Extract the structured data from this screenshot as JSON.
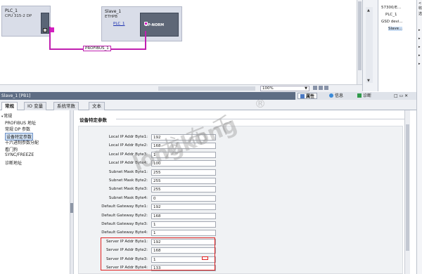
{
  "network": {
    "plc": {
      "name": "PLC_1",
      "type": "CPU 315-2 DP"
    },
    "slave": {
      "name": "Slave_1",
      "type": "ETHPB",
      "link": "PLC_1",
      "module_label": "DP-NORM"
    },
    "bus_label": "PROFIBUS_1",
    "zoom": "100%"
  },
  "catalog": {
    "rows": [
      "57300/E...",
      "PLC_1",
      "GSD devi...",
      "Slave..."
    ]
  },
  "far_right": {
    "top_label": "<收",
    "top2": "选"
  },
  "inspector": {
    "title": "Slave_1 [PB1]",
    "tabs": {
      "properties": "属性",
      "info": "信息",
      "diagnostics": "诊断"
    },
    "sub_tabs": [
      "常规",
      "IO 变量",
      "系统常数",
      "文本"
    ]
  },
  "nav": {
    "items": [
      {
        "label": "常规",
        "expand": true,
        "selected": false,
        "indent": 0
      },
      {
        "label": "PROFIBUS 地址",
        "expand": false,
        "selected": false,
        "indent": 1
      },
      {
        "label": "常规 DP 参数",
        "expand": false,
        "selected": false,
        "indent": 1
      },
      {
        "label": "设备特定参数",
        "expand": false,
        "selected": true,
        "indent": 1
      },
      {
        "label": "十六进制参数分配",
        "expand": false,
        "selected": false,
        "indent": 1
      },
      {
        "label": "看门狗",
        "expand": false,
        "selected": false,
        "indent": 1
      },
      {
        "label": "SYNC/FREEZE",
        "expand": false,
        "selected": false,
        "indent": 1
      },
      {
        "label": "诊断地址",
        "expand": false,
        "selected": false,
        "indent": 1
      }
    ]
  },
  "section": {
    "title": "设备特定参数"
  },
  "params": [
    {
      "label": "Local IP Addr Byte1:",
      "value": "192"
    },
    {
      "label": "Local IP Addr Byte2:",
      "value": "168"
    },
    {
      "label": "Local IP Addr Byte3:",
      "value": "1"
    },
    {
      "label": "Local IP Addr Byte4:",
      "value": "100"
    },
    {
      "label": "Subnet Mask Byte1:",
      "value": "255"
    },
    {
      "label": "Subnet Mask Byte2:",
      "value": "255"
    },
    {
      "label": "Subnet Mask Byte3:",
      "value": "255"
    },
    {
      "label": "Subnet Mask Byte4:",
      "value": "0"
    },
    {
      "label": "Default Gateway Byte1:",
      "value": "192"
    },
    {
      "label": "Default Gateway Byte2:",
      "value": "168"
    },
    {
      "label": "Default Gateway Byte3:",
      "value": "1"
    },
    {
      "label": "Default Gateway Byte4:",
      "value": "1"
    },
    {
      "label": "Server IP Addr Byte1:",
      "value": "192"
    },
    {
      "label": "Server IP Addr Byte2:",
      "value": "168"
    },
    {
      "label": "Server IP Addr Byte3:",
      "value": "1"
    },
    {
      "label": "Server IP Addr Byte4:",
      "value": "133"
    }
  ],
  "watermark": {
    "cn": "龙 布 千",
    "en": "longkong",
    "mark": "®"
  },
  "colors": {
    "profibus": "#c020b0",
    "highlight": "#e02020",
    "header": "#5e6d84"
  }
}
